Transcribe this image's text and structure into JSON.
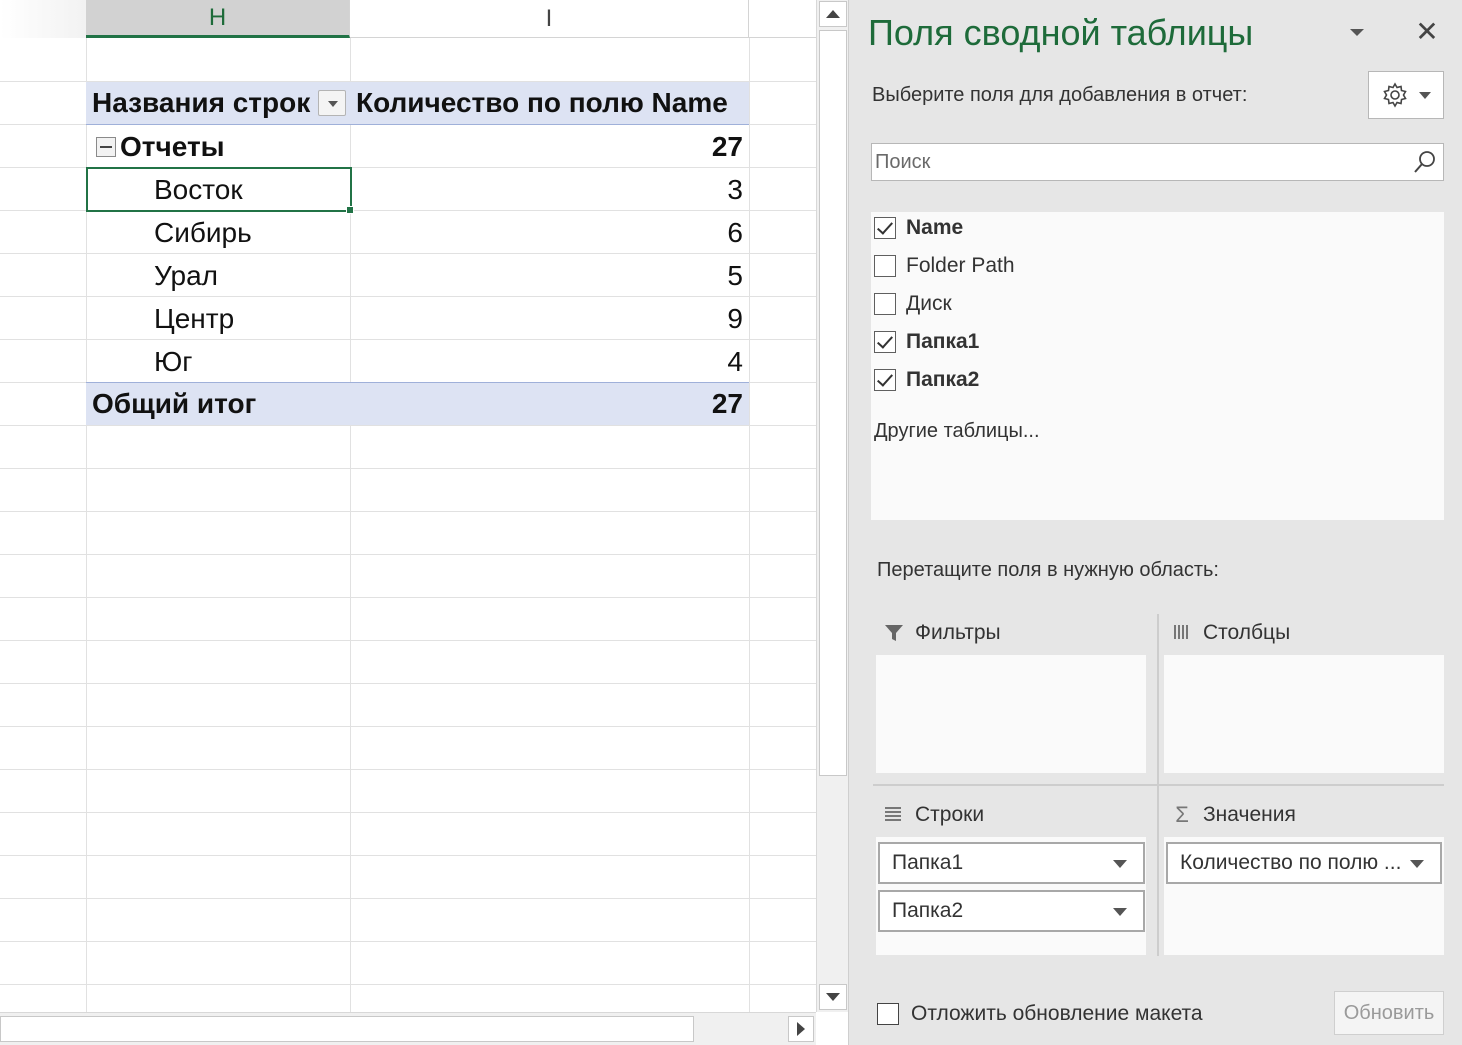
{
  "sheet": {
    "columns": [
      {
        "letter": "H",
        "selected": true
      },
      {
        "letter": "I",
        "selected": false
      }
    ],
    "pivot": {
      "header_row_label": "Названия строк",
      "header_value_label": "Количество по полю Name",
      "group": {
        "label": "Отчеты",
        "value": "27"
      },
      "items": [
        {
          "label": "Восток",
          "value": "3"
        },
        {
          "label": "Сибирь",
          "value": "6"
        },
        {
          "label": "Урал",
          "value": "5"
        },
        {
          "label": "Центр",
          "value": "9"
        },
        {
          "label": "Юг",
          "value": "4"
        }
      ],
      "grand_total": {
        "label": "Общий итог",
        "value": "27"
      }
    },
    "selected_cell_value": "Восток"
  },
  "pane": {
    "title": "Поля сводной таблицы",
    "subtitle": "Выберите поля для добавления в отчет:",
    "search_placeholder": "Поиск",
    "fields": [
      {
        "label": "Name",
        "checked": true
      },
      {
        "label": "Folder Path",
        "checked": false
      },
      {
        "label": "Диск",
        "checked": false
      },
      {
        "label": "Папка1",
        "checked": true
      },
      {
        "label": "Папка2",
        "checked": true
      }
    ],
    "other_tables": "Другие таблицы...",
    "drag_label": "Перетащите поля в нужную область:",
    "areas": {
      "filters": {
        "label": "Фильтры",
        "icon": "filter-icon",
        "items": []
      },
      "columns": {
        "label": "Столбцы",
        "icon": "columns-icon",
        "items": []
      },
      "rows": {
        "label": "Строки",
        "icon": "rows-icon",
        "items": [
          "Папка1",
          "Папка2"
        ]
      },
      "values": {
        "label": "Значения",
        "icon": "sigma-icon",
        "items": [
          "Количество по полю ..."
        ]
      }
    },
    "defer_label": "Отложить обновление макета",
    "defer_checked": false,
    "update_label": "Обновить"
  },
  "colors": {
    "accent_green": "#217346",
    "title_green": "#1e6b3a",
    "pivot_header_fill": "#dde3f3"
  }
}
